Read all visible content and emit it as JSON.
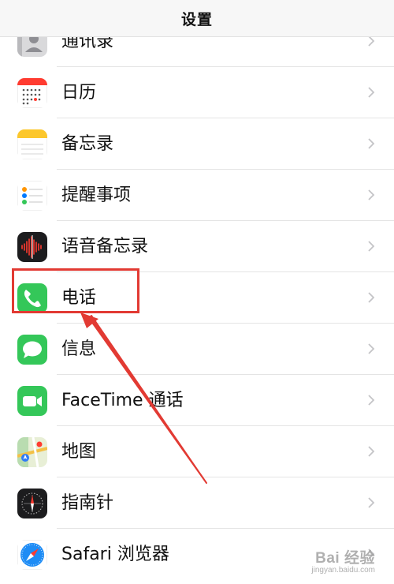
{
  "header": {
    "title": "设置"
  },
  "rows": [
    {
      "label": "通讯录",
      "icon": "contacts-icon"
    },
    {
      "label": "日历",
      "icon": "calendar-icon"
    },
    {
      "label": "备忘录",
      "icon": "notes-icon"
    },
    {
      "label": "提醒事项",
      "icon": "reminders-icon"
    },
    {
      "label": "语音备忘录",
      "icon": "voice-memos-icon"
    },
    {
      "label": "电话",
      "icon": "phone-icon"
    },
    {
      "label": "信息",
      "icon": "messages-icon"
    },
    {
      "label": "FaceTime 通话",
      "icon": "facetime-icon"
    },
    {
      "label": "地图",
      "icon": "maps-icon"
    },
    {
      "label": "指南针",
      "icon": "compass-icon"
    },
    {
      "label": "Safari 浏览器",
      "icon": "safari-icon"
    }
  ],
  "annotation": {
    "highlighted_item": "电话",
    "color": "#e23a33"
  },
  "watermark": {
    "brand": "Bai 经验",
    "url": "jingyan.baidu.com"
  },
  "colors": {
    "accent_red": "#e23a33",
    "phone_green": "#34c759",
    "separator": "#e4e4e4",
    "chevron": "#c4c4c7"
  }
}
